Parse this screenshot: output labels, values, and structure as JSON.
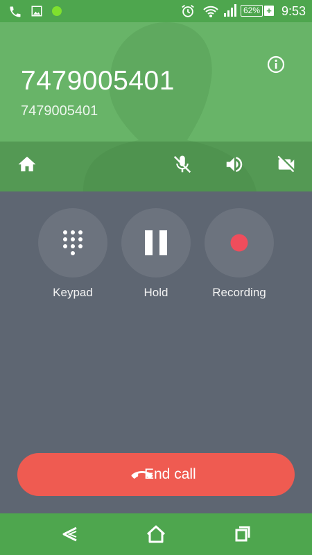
{
  "status_bar": {
    "time": "9:53",
    "battery_percent": "62%",
    "icons": [
      "phone-icon",
      "image-icon",
      "green-dot-icon",
      "alarm-icon",
      "wifi-icon",
      "signal-icon",
      "battery-icon",
      "charging-plus-icon"
    ]
  },
  "call": {
    "caller_name": "7479005401",
    "caller_number": "7479005401",
    "header_color": "#68b468"
  },
  "header_actions": [
    {
      "name": "home-icon"
    },
    {
      "name": "mute-icon"
    },
    {
      "name": "speaker-icon"
    },
    {
      "name": "video-off-icon"
    }
  ],
  "actions": {
    "keypad": {
      "label": "Keypad",
      "icon": "dialpad-icon"
    },
    "hold": {
      "label": "Hold",
      "icon": "pause-icon"
    },
    "recording": {
      "label": "Recording",
      "icon": "record-icon",
      "color": "#ef4d5c"
    }
  },
  "end_call": {
    "label": "End call",
    "color": "#ef5b51",
    "icon": "hang-up-icon"
  },
  "nav": [
    "back-icon",
    "home-nav-icon",
    "recents-icon"
  ]
}
